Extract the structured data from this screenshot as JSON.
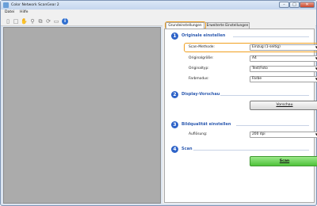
{
  "window": {
    "title": "Color Network ScanGear 2"
  },
  "menubar": {
    "items": [
      "Datei",
      "Hilfe"
    ]
  },
  "tabs": [
    {
      "label": "Grundeinstellungen"
    },
    {
      "label": "Erweiterte Einstellungen"
    }
  ],
  "sections": {
    "original": {
      "number": "1",
      "title": "Originale einstellen"
    },
    "preview": {
      "number": "2",
      "title": "Display-Vorschau"
    },
    "quality": {
      "number": "3",
      "title": "Bildqualität einstellen"
    },
    "scan": {
      "number": "4",
      "title": "Scan"
    }
  },
  "fields": {
    "scan_method": {
      "label": "Scan-Methode:",
      "value": "Einzug (1-seitig)"
    },
    "original_size": {
      "label": "Originalgröße:",
      "value": "A4"
    },
    "original_type": {
      "label": "Originaltyp:",
      "value": "Text/Foto"
    },
    "color_mode": {
      "label": "Farbmodus:",
      "value": "Farbe"
    },
    "resolution": {
      "label": "Auflösung:",
      "value": "200 dpi"
    }
  },
  "buttons": {
    "preview": "Vorschau",
    "scan": "Scan"
  },
  "colors": {
    "highlight": "#f0a020",
    "section_number": "#2e63c8",
    "scan_button": "#4ec23a"
  }
}
